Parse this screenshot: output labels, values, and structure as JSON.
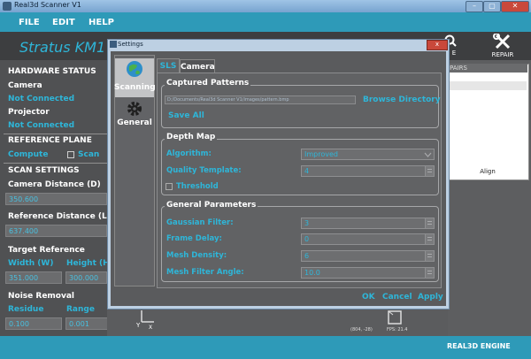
{
  "window": {
    "title": "Real3d Scanner V1"
  },
  "menu": {
    "items": [
      "FILE",
      "EDIT",
      "HELP"
    ]
  },
  "brand": {
    "text": "Stratus KM1"
  },
  "toolbar": {
    "engine_partial": "E",
    "repair_label": "REPAIR"
  },
  "left_panel": {
    "hardware_status": "HARDWARE STATUS",
    "camera_label": "Camera",
    "camera_status": "Not Connected",
    "projector_label": "Projector",
    "projector_status": "Not Connected",
    "reference_plane": "REFERENCE PLANE",
    "compute_label": "Compute",
    "scan_label": "Scan",
    "scan_settings": "SCAN SETTINGS",
    "camera_distance_label": "Camera Distance (D)",
    "camera_distance_value": "350.600",
    "reference_distance_label": "Reference Distance (L)",
    "reference_distance_value": "637.400",
    "target_reference": "Target Reference",
    "width_label": "Width (W)",
    "height_label": "Height (H)",
    "width_value": "351.000",
    "height_value": "300.000",
    "noise_removal": "Noise Removal",
    "residue_label": "Residue",
    "range_label": "Range",
    "residue_value": "0.100",
    "range_value": "0.001"
  },
  "right_panel": {
    "header": "PAIRS",
    "align_label": "Align"
  },
  "viewport": {
    "coords": "(804, -28)",
    "fps": "FPS: 21.4"
  },
  "footer": {
    "engine_label": "REAL3D ENGINE"
  },
  "settings": {
    "title": "Settings",
    "close": "x",
    "nav": {
      "scanning": "Scanning",
      "general": "General"
    },
    "tabs": [
      "SLS",
      "Camera"
    ],
    "captured_patterns": {
      "title": "Captured Patterns",
      "path": "D:/Documents/Real3d Scanner V1/images/pattern.bmp",
      "browse": "Browse Directory",
      "save_all": "Save All"
    },
    "depth_map": {
      "title": "Depth Map",
      "algorithm_label": "Algorithm:",
      "algorithm_value": "Improved",
      "quality_label": "Quality Template:",
      "quality_value": "4",
      "threshold_label": "Threshold"
    },
    "general_parameters": {
      "title": "General Parameters",
      "gaussian_label": "Gaussian Filter:",
      "gaussian_value": "3",
      "frame_delay_label": "Frame Delay:",
      "frame_delay_value": "0",
      "mesh_density_label": "Mesh Density:",
      "mesh_density_value": "6",
      "mesh_filter_label": "Mesh Filter Angle:",
      "mesh_filter_value": "10.0"
    },
    "buttons": {
      "ok": "OK",
      "cancel": "Cancel",
      "apply": "Apply"
    }
  },
  "colors": {
    "accent": "#2eb6d9",
    "menubar": "#2e9ab8",
    "close": "#c9483b"
  }
}
